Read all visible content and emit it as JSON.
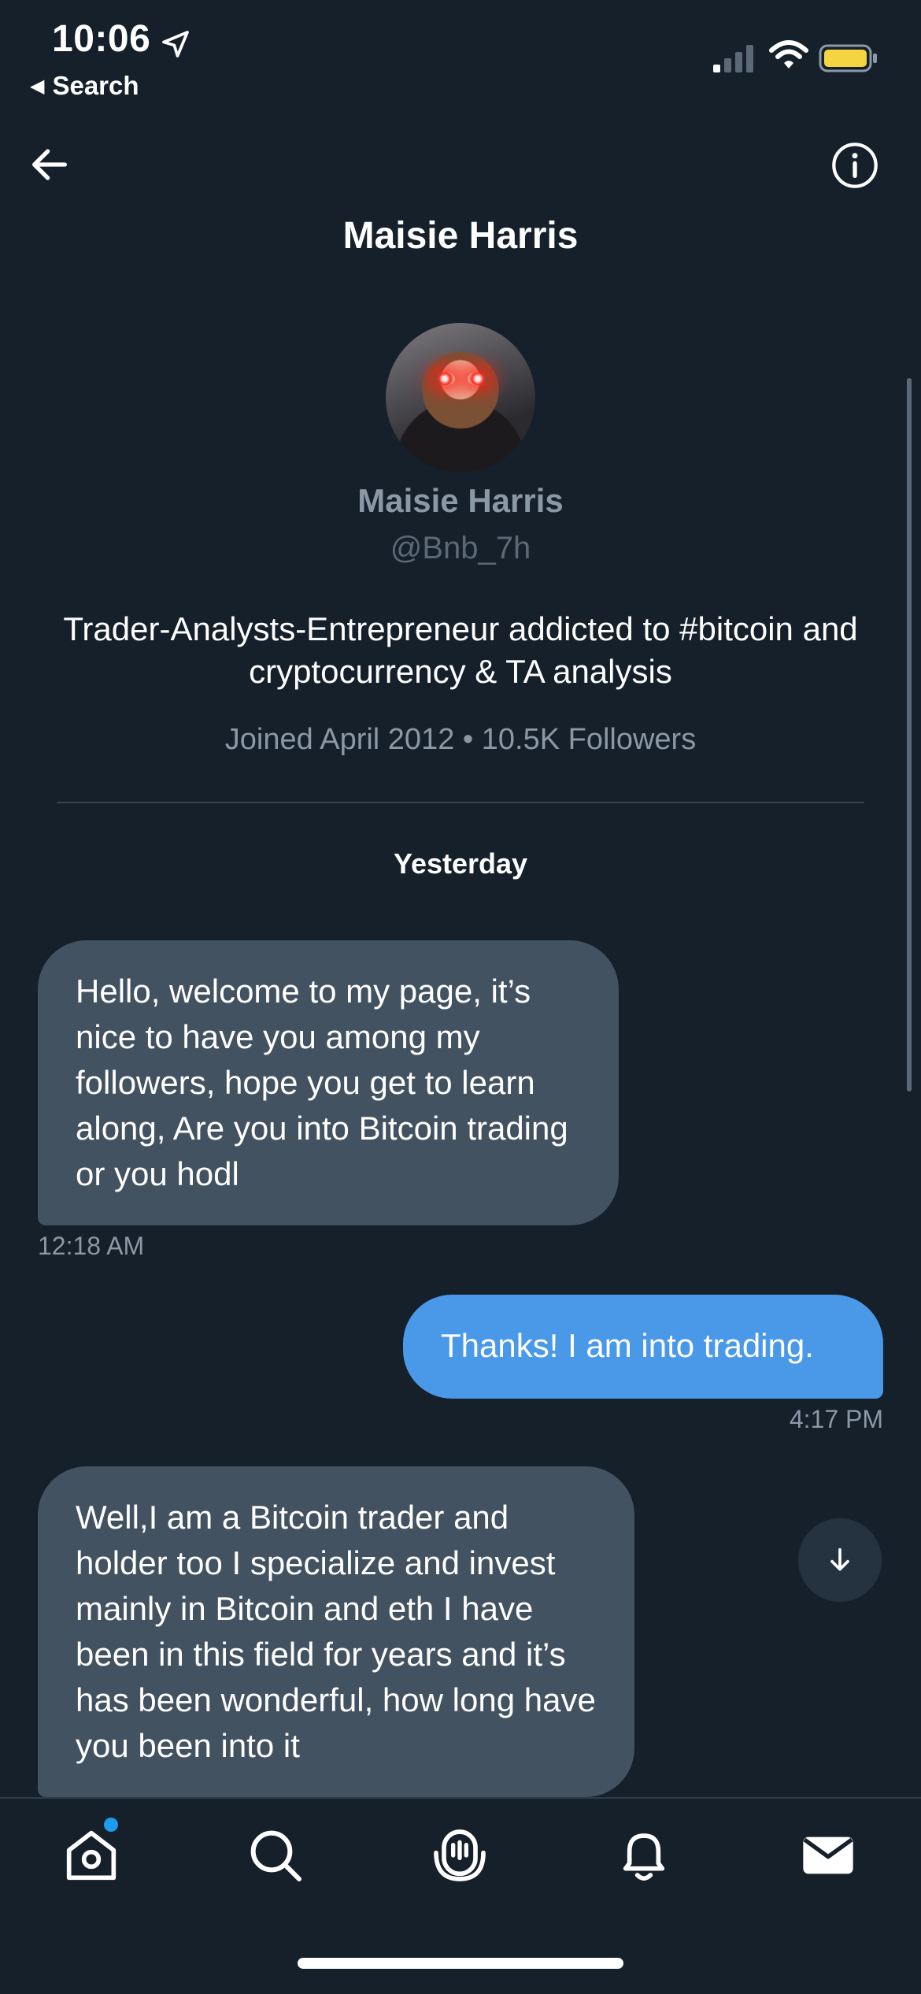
{
  "status_bar": {
    "time": "10:06",
    "back_app": "Search"
  },
  "header": {
    "title": "Maisie Harris"
  },
  "profile": {
    "name": "Maisie Harris",
    "handle": "@Bnb_7h",
    "bio": "Trader-Analysts-Entrepreneur addicted to #bitcoin and cryptocurrency & TA analysis",
    "meta": "Joined April 2012 • 10.5K Followers"
  },
  "conversation": {
    "day_label": "Yesterday",
    "messages": [
      {
        "direction": "incoming",
        "text": "Hello, welcome to my page, it’s nice to have you among my followers, hope you get to learn along, Are you into Bitcoin trading or you hodl",
        "time": "12:18 AM"
      },
      {
        "direction": "outgoing",
        "text": "Thanks! I am into trading.",
        "time": "4:17 PM"
      },
      {
        "direction": "incoming",
        "text": "Well,I am a Bitcoin trader and holder too I specialize and invest mainly in Bitcoin and eth I have been in this field  for years and it’s has been wonderful, how long have you been into it",
        "time": ""
      }
    ]
  },
  "icons": {
    "status": [
      "location-arrow-icon",
      "signal-icon",
      "wifi-icon",
      "battery-icon"
    ],
    "header": [
      "back-arrow-icon",
      "info-icon"
    ],
    "tabs": [
      "home-icon",
      "search-icon",
      "spaces-icon",
      "bell-icon",
      "mail-icon"
    ],
    "scroll": "arrow-down-icon"
  },
  "colors": {
    "background": "#15202b",
    "incoming_bubble": "#435261",
    "outgoing_bubble": "#4a99e9",
    "secondary_text": "#8b98a5",
    "accent_dot": "#1d9bf0",
    "battery": "#f5d442"
  }
}
